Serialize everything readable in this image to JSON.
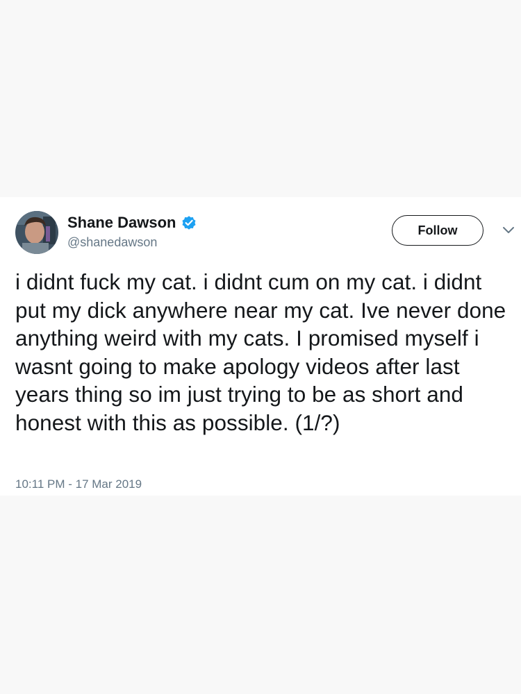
{
  "author": {
    "name": "Shane Dawson",
    "handle": "@shanedawson",
    "verified": true,
    "verified_icon": "verified-badge-icon",
    "avatar_icon": "profile-photo"
  },
  "actions": {
    "follow_label": "Follow",
    "menu_icon": "chevron-down-icon"
  },
  "tweet": {
    "text": "i didnt fuck my cat. i didnt cum on my cat. i didnt put my dick anywhere near my cat. Ive never done anything weird with my cats. I promised myself i wasnt going to make apology videos after last years thing so im just trying to be as short and honest with this as possible. (1/?)",
    "timestamp": "10:11 PM - 17 Mar 2019"
  },
  "colors": {
    "page_background": "#f8f8f8",
    "card_background": "#ffffff",
    "text_primary": "#14171a",
    "text_secondary": "#657786",
    "verified_blue": "#1da1f2"
  }
}
